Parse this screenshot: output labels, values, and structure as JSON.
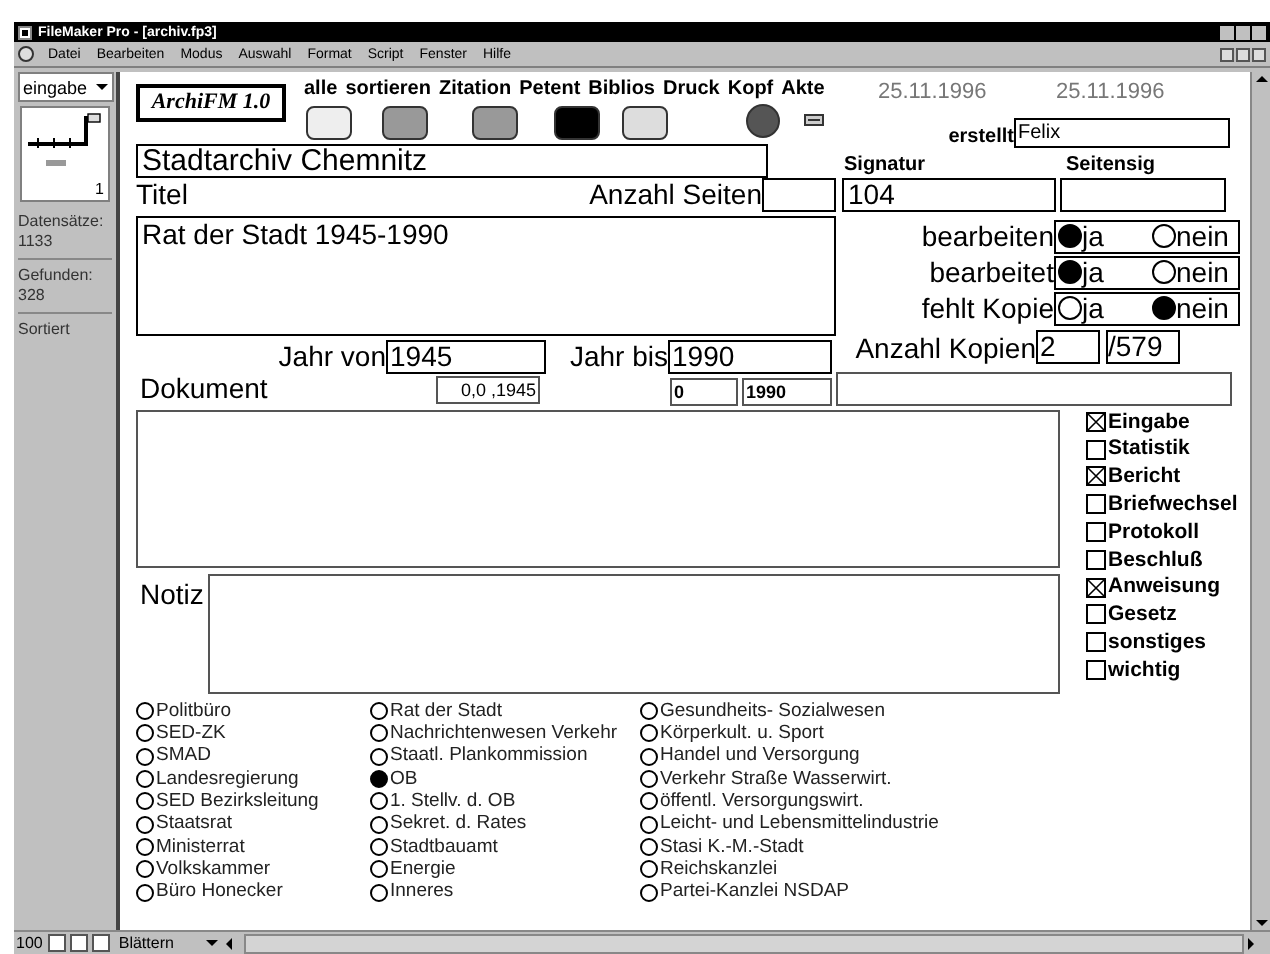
{
  "window": {
    "title": "FileMaker Pro - [archiv.fp3]",
    "menu": [
      "Datei",
      "Bearbeiten",
      "Modus",
      "Auswahl",
      "Format",
      "Script",
      "Fenster",
      "Hilfe"
    ]
  },
  "status_panel": {
    "layout": "eingabe",
    "record": "1",
    "records_label": "Datensätze:",
    "records": "1133",
    "found_label": "Gefunden:",
    "found": "328",
    "sorted": "Sortiert"
  },
  "logo": "ArchiFM 1.0",
  "buttons": [
    {
      "label": "alle",
      "color": "#eeeeee"
    },
    {
      "label": "sortieren",
      "color": "#999999"
    },
    {
      "label": "Zitation",
      "color": "#999999"
    },
    {
      "label": "Petent",
      "color": "#000000"
    },
    {
      "label": "Biblios",
      "color": "#dddddd"
    }
  ],
  "labels": {
    "druck": "Druck",
    "kopf": "Kopf",
    "akte": "Akte"
  },
  "dates": [
    "25.11.1996",
    "25.11.1996"
  ],
  "created": {
    "label": "erstellt",
    "value": "Felix"
  },
  "archive": "Stadtarchiv Chemnitz",
  "signatur": {
    "label": "Signatur",
    "value": "104"
  },
  "seitensig": {
    "label": "Seitensig"
  },
  "titel": {
    "label": "Titel",
    "value": "Rat der Stadt 1945-1990"
  },
  "pages": {
    "label": "Anzahl Seiten"
  },
  "status_radios": [
    {
      "label": "bearbeiten",
      "options": [
        {
          "label": "ja",
          "selected": true
        },
        {
          "label": "nein",
          "selected": false
        }
      ]
    },
    {
      "label": "bearbeitet",
      "options": [
        {
          "label": "ja",
          "selected": true
        },
        {
          "label": "nein",
          "selected": false
        }
      ]
    },
    {
      "label": "fehlt Kopie",
      "options": [
        {
          "label": "ja",
          "selected": false
        },
        {
          "label": "nein",
          "selected": true
        }
      ]
    }
  ],
  "copies": {
    "label": "Anzahl Kopien",
    "value": "2",
    "total": "/579"
  },
  "year_from": {
    "label": "Jahr von",
    "value": "1945"
  },
  "year_to": {
    "label": "Jahr bis",
    "value": "1990"
  },
  "document": {
    "label": "Dokument",
    "date": "0,0 ,1945",
    "from": "0",
    "to": "1990"
  },
  "notiz": {
    "label": "Notiz"
  },
  "types": [
    {
      "label": "Eingabe",
      "checked": true
    },
    {
      "label": "Statistik",
      "checked": false
    },
    {
      "label": "Bericht",
      "checked": true
    },
    {
      "label": "Briefwechsel",
      "checked": false
    },
    {
      "label": "Protokoll",
      "checked": false
    },
    {
      "label": "Beschluß",
      "checked": false
    },
    {
      "label": "Anweisung",
      "checked": true
    },
    {
      "label": "Gesetz",
      "checked": false
    },
    {
      "label": "sonstiges",
      "checked": false
    },
    {
      "label": "wichtig",
      "checked": false
    }
  ],
  "origin_columns": [
    {
      "options": [
        {
          "label": "Politbüro",
          "selected": false
        },
        {
          "label": "SED-ZK",
          "selected": false
        },
        {
          "label": "SMAD",
          "selected": false
        },
        {
          "label": "Landesregierung",
          "selected": false
        },
        {
          "label": "SED Bezirksleitung",
          "selected": false
        },
        {
          "label": "Staatsrat",
          "selected": false
        },
        {
          "label": "Ministerrat",
          "selected": false
        },
        {
          "label": "Volkskammer",
          "selected": false
        },
        {
          "label": "Büro Honecker",
          "selected": false
        }
      ]
    },
    {
      "options": [
        {
          "label": "Rat der Stadt",
          "selected": false
        },
        {
          "label": "Nachrichtenwesen Verkehr",
          "selected": false
        },
        {
          "label": "Staatl. Plankommission",
          "selected": false
        },
        {
          "label": "OB",
          "selected": true
        },
        {
          "label": "1. Stellv. d. OB",
          "selected": false
        },
        {
          "label": "Sekret. d. Rates",
          "selected": false
        },
        {
          "label": "Stadtbauamt",
          "selected": false
        },
        {
          "label": "Energie",
          "selected": false
        },
        {
          "label": "Inneres",
          "selected": false
        }
      ]
    },
    {
      "options": [
        {
          "label": "Gesundheits- Sozialwesen",
          "selected": false
        },
        {
          "label": "Körperkult. u. Sport",
          "selected": false
        },
        {
          "label": "Handel und Versorgung",
          "selected": false
        },
        {
          "label": "Verkehr Straße Wasserwirt.",
          "selected": false
        },
        {
          "label": "öffentl. Versorgungswirt.",
          "selected": false
        },
        {
          "label": "Leicht- und Lebensmittelindustrie",
          "selected": false
        },
        {
          "label": "Stasi K.-M.-Stadt",
          "selected": false
        },
        {
          "label": "Reichskanzlei",
          "selected": false
        },
        {
          "label": "Partei-Kanzlei NSDAP",
          "selected": false
        }
      ]
    }
  ],
  "bottom_bar": {
    "zoom": "100",
    "mode": "Blättern"
  }
}
